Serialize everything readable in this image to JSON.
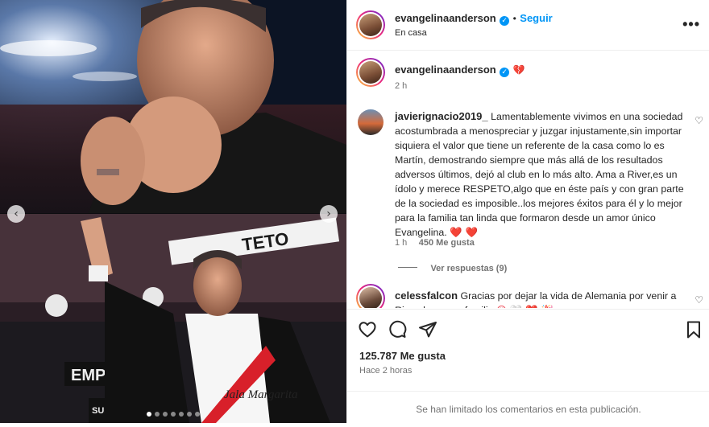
{
  "post": {
    "username": "evangelinaanderson",
    "follow_label": "Seguir",
    "location": "En casa",
    "more_label": "•••"
  },
  "caption": {
    "username": "evangelinaanderson",
    "emoji": "💔",
    "time": "2 h"
  },
  "comments": [
    {
      "username": "javierignacio2019_",
      "text": "Lamentablemente vivimos en una sociedad acostumbrada a menospreciar y juzgar injustamente,sin importar siquiera el valor que tiene un referente de la casa como lo es Martín, demostrando siempre que más allá de los resultados adversos últimos, dejó al club en lo más alto. Ama a River,es un ídolo y merece RESPETO,algo que en éste país y con gran parte de la sociedad es imposible..los mejores éxitos para él y lo mejor para la familia tan linda que formaron desde un amor único Evangelina.",
      "hearts": "❤️ ❤️",
      "time": "1 h",
      "likes": "450 Me gusta",
      "replies": "Ver respuestas (9)"
    },
    {
      "username": "celessfalcon",
      "text": "Gracias por dejar la vida de Alemania por venir a River, hermosa familia",
      "hearts": "😍 🤍 ❤️ 🎉"
    }
  ],
  "stats": {
    "likes": "125.787 Me gusta",
    "time": "Hace 2 horas"
  },
  "footer": {
    "limited": "Se han limitado los comentarios en esta publicación."
  },
  "media": {
    "banner_text_1": "TETO",
    "banner_text_2": "EMPRE",
    "banner_text_3": "SUPER",
    "banner_text_4": "MA",
    "jersey_sponsor": "Jala Margarita"
  }
}
